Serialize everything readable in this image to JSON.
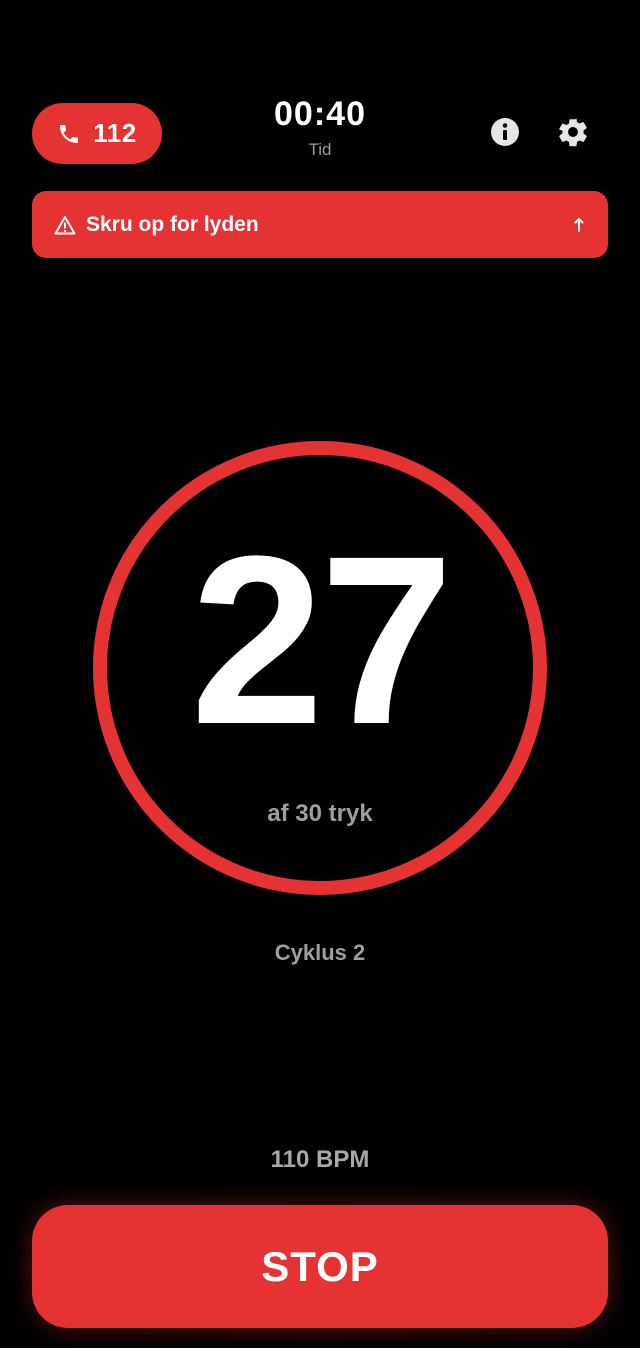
{
  "header": {
    "emergency_call": {
      "label": "112",
      "icon": "phone-icon"
    },
    "timer": {
      "value": "00:40",
      "label": "Tid"
    },
    "info_icon": "info-icon",
    "settings_icon": "gear-icon"
  },
  "banner": {
    "icon": "warning-icon",
    "text": "Skru op for lyden",
    "trailing_icon": "arrow-up-icon"
  },
  "counter": {
    "value": "27",
    "subtitle": "af 30 tryk"
  },
  "cycle": {
    "label": "Cyklus 2"
  },
  "tempo": {
    "label": "110 BPM"
  },
  "stop_button": {
    "label": "STOP"
  },
  "colors": {
    "accent": "#e53333",
    "background": "#000000",
    "muted_text": "#9f9f9f"
  }
}
